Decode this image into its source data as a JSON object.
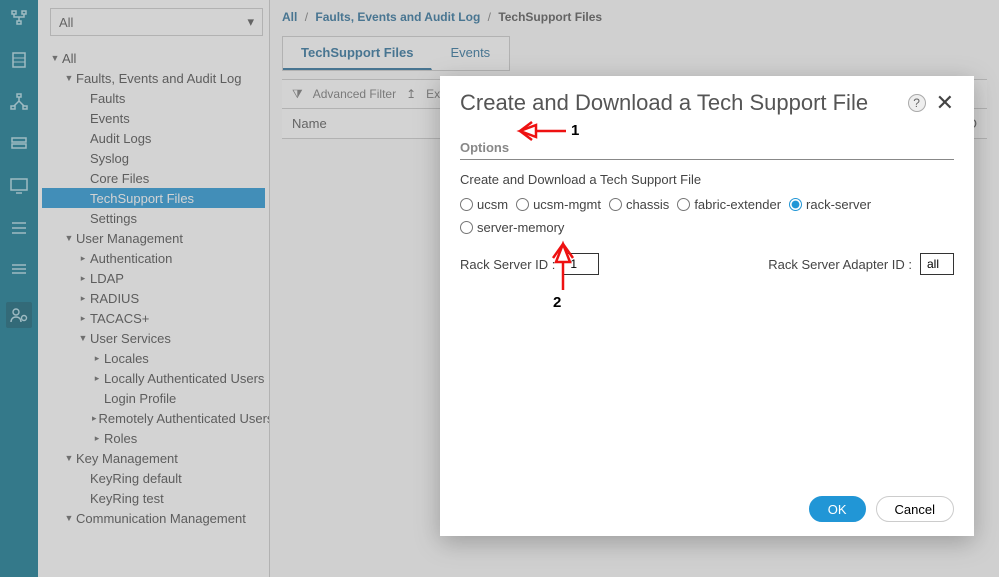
{
  "sidebar_icons": [
    {
      "name": "network-icon"
    },
    {
      "name": "server-icon"
    },
    {
      "name": "topology-icon"
    },
    {
      "name": "storage-icon"
    },
    {
      "name": "monitor-icon"
    },
    {
      "name": "list-icon"
    },
    {
      "name": "rows-icon"
    },
    {
      "name": "admin-icon"
    }
  ],
  "nav": {
    "dropdown": "All",
    "tree": [
      {
        "label": "All",
        "indent": 0,
        "caret": "▼"
      },
      {
        "label": "Faults, Events and Audit Log",
        "indent": 1,
        "caret": "▼"
      },
      {
        "label": "Faults",
        "indent": 2,
        "caret": ""
      },
      {
        "label": "Events",
        "indent": 2,
        "caret": ""
      },
      {
        "label": "Audit Logs",
        "indent": 2,
        "caret": ""
      },
      {
        "label": "Syslog",
        "indent": 2,
        "caret": ""
      },
      {
        "label": "Core Files",
        "indent": 2,
        "caret": ""
      },
      {
        "label": "TechSupport Files",
        "indent": 2,
        "caret": "",
        "selected": true
      },
      {
        "label": "Settings",
        "indent": 2,
        "caret": ""
      },
      {
        "label": "User Management",
        "indent": 1,
        "caret": "▼"
      },
      {
        "label": "Authentication",
        "indent": 2,
        "caret": "▸"
      },
      {
        "label": "LDAP",
        "indent": 2,
        "caret": "▸"
      },
      {
        "label": "RADIUS",
        "indent": 2,
        "caret": "▸"
      },
      {
        "label": "TACACS+",
        "indent": 2,
        "caret": "▸"
      },
      {
        "label": "User Services",
        "indent": 2,
        "caret": "▼"
      },
      {
        "label": "Locales",
        "indent": 3,
        "caret": "▸"
      },
      {
        "label": "Locally Authenticated Users",
        "indent": 3,
        "caret": "▸"
      },
      {
        "label": "Login Profile",
        "indent": 3,
        "caret": ""
      },
      {
        "label": "Remotely Authenticated Users",
        "indent": 3,
        "caret": "▸"
      },
      {
        "label": "Roles",
        "indent": 3,
        "caret": "▸"
      },
      {
        "label": "Key Management",
        "indent": 1,
        "caret": "▼"
      },
      {
        "label": "KeyRing default",
        "indent": 2,
        "caret": ""
      },
      {
        "label": "KeyRing test",
        "indent": 2,
        "caret": ""
      },
      {
        "label": "Communication Management",
        "indent": 1,
        "caret": "▼"
      }
    ]
  },
  "breadcrumb": {
    "a": "All",
    "b": "Faults, Events and Audit Log",
    "c": "TechSupport Files"
  },
  "tabs": [
    {
      "label": "TechSupport Files",
      "active": true
    },
    {
      "label": "Events",
      "active": false
    }
  ],
  "toolbar": {
    "advanced_filter": "Advanced Filter",
    "export": "Export"
  },
  "table": {
    "col_name": "Name",
    "col_ric": "ric ID"
  },
  "modal": {
    "title": "Create and Download a Tech Support File",
    "options": "Options",
    "subtitle": "Create and Download a Tech Support File",
    "radios": [
      {
        "label": "ucsm",
        "checked": false
      },
      {
        "label": "ucsm-mgmt",
        "checked": false
      },
      {
        "label": "chassis",
        "checked": false
      },
      {
        "label": "fabric-extender",
        "checked": false
      },
      {
        "label": "rack-server",
        "checked": true
      },
      {
        "label": "server-memory",
        "checked": false
      }
    ],
    "rack_server_label": "Rack Server ID :",
    "rack_server_value": "1",
    "adapter_label": "Rack Server Adapter ID :",
    "adapter_value": "all",
    "ok": "OK",
    "cancel": "Cancel"
  },
  "annotations": {
    "one": "1",
    "two": "2"
  }
}
